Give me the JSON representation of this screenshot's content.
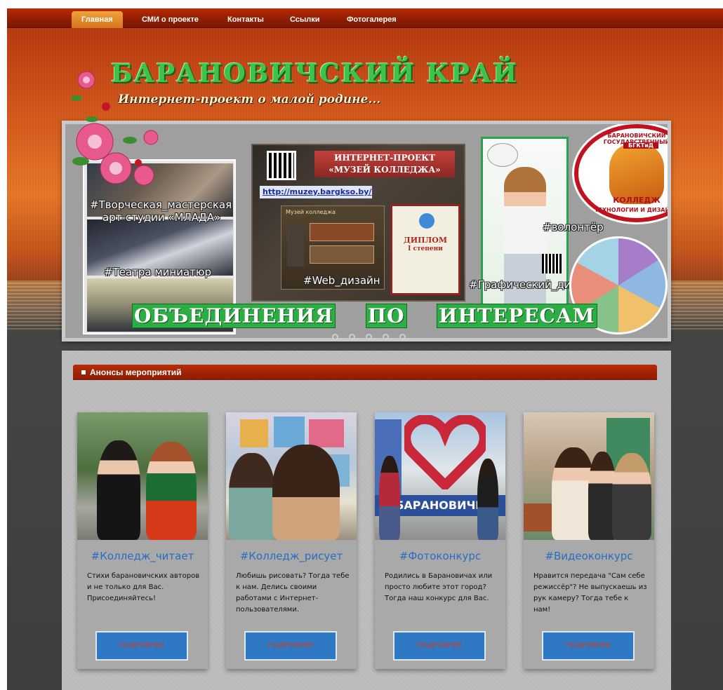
{
  "nav": {
    "items": [
      {
        "label": "Главная",
        "active": true
      },
      {
        "label": "СМИ о проекте",
        "active": false
      },
      {
        "label": "Контакты",
        "active": false
      },
      {
        "label": "Ссылки",
        "active": false
      },
      {
        "label": "Фотогалерея",
        "active": false
      }
    ]
  },
  "header": {
    "title": "БАРАНОВИЧСКИЙ КРАЙ",
    "subtitle": "Интернет-проект о малой родине..."
  },
  "slider": {
    "hashtags": {
      "studio": "#Творческая_мастерская",
      "studio2": "арт-студии «МЛАДА»",
      "theatre": "#Театра миниатюр",
      "web": "#Web_дизайн",
      "graphic": "#Графический_дизайн",
      "volunteer": "#волонтёр"
    },
    "museum": {
      "line1": "ИНТЕРНЕТ-ПРОЕКТ",
      "line2": "«МУЗЕЙ КОЛЛЕДЖА»",
      "url": "http://muzey.bargkso.by/",
      "screen_title": "Музей колледжа",
      "diploma_title": "ДИПЛОМ",
      "diploma_sub": "I степени"
    },
    "emblem": {
      "top": "БАРАНОВИЧСКИЙ ГОСУДАРСТВЕННЫЙ",
      "abbr": "БГКТиД",
      "middle": "КОЛЛЕДЖ",
      "bottom": "ТЕХНОЛОГИИ И ДИЗАЙНА"
    },
    "banner_words": [
      "ОБЪЕДИНЕНИЯ",
      "ПО",
      "ИНТЕРЕСАМ"
    ],
    "dots_count": 5,
    "active_dot": 0
  },
  "announcements": {
    "title": "Анонсы мероприятий",
    "cards": [
      {
        "title": "#Колледж_читает",
        "text": "Стихи барановичских авторов и не только для Вас. Присоединяйтесь!",
        "button": "ПОДРОБНЕЕ"
      },
      {
        "title": "#Колледж_рисует",
        "text": "Любишь рисовать? Тогда тебе к нам. Делись своими работами с Интернет-пользователями.",
        "button": "ПОДРОБНЕЕ"
      },
      {
        "title": "#Фотоконкурс",
        "text": "Родились в Барановичах или просто любите этот город? Тогда наш конкурс для Вас.",
        "button": "ПОДРОБНЕЕ"
      },
      {
        "title": "#Видеоконкурс",
        "text": "Нравится передача \"Сам себе режиссёр\"? Не выпускаешь из рук камеру? Тогда тебе к нам!",
        "button": "ПОДРОБНЕЕ"
      }
    ]
  },
  "colors": {
    "nav_bg": "#a3240a",
    "nav_active": "#e28b2a",
    "section_bar": "#a2260a",
    "card_title": "#2b6cc2",
    "button_bg": "#2f78c4",
    "button_text": "#d23a1a",
    "logo_green": "#3ec24a"
  }
}
